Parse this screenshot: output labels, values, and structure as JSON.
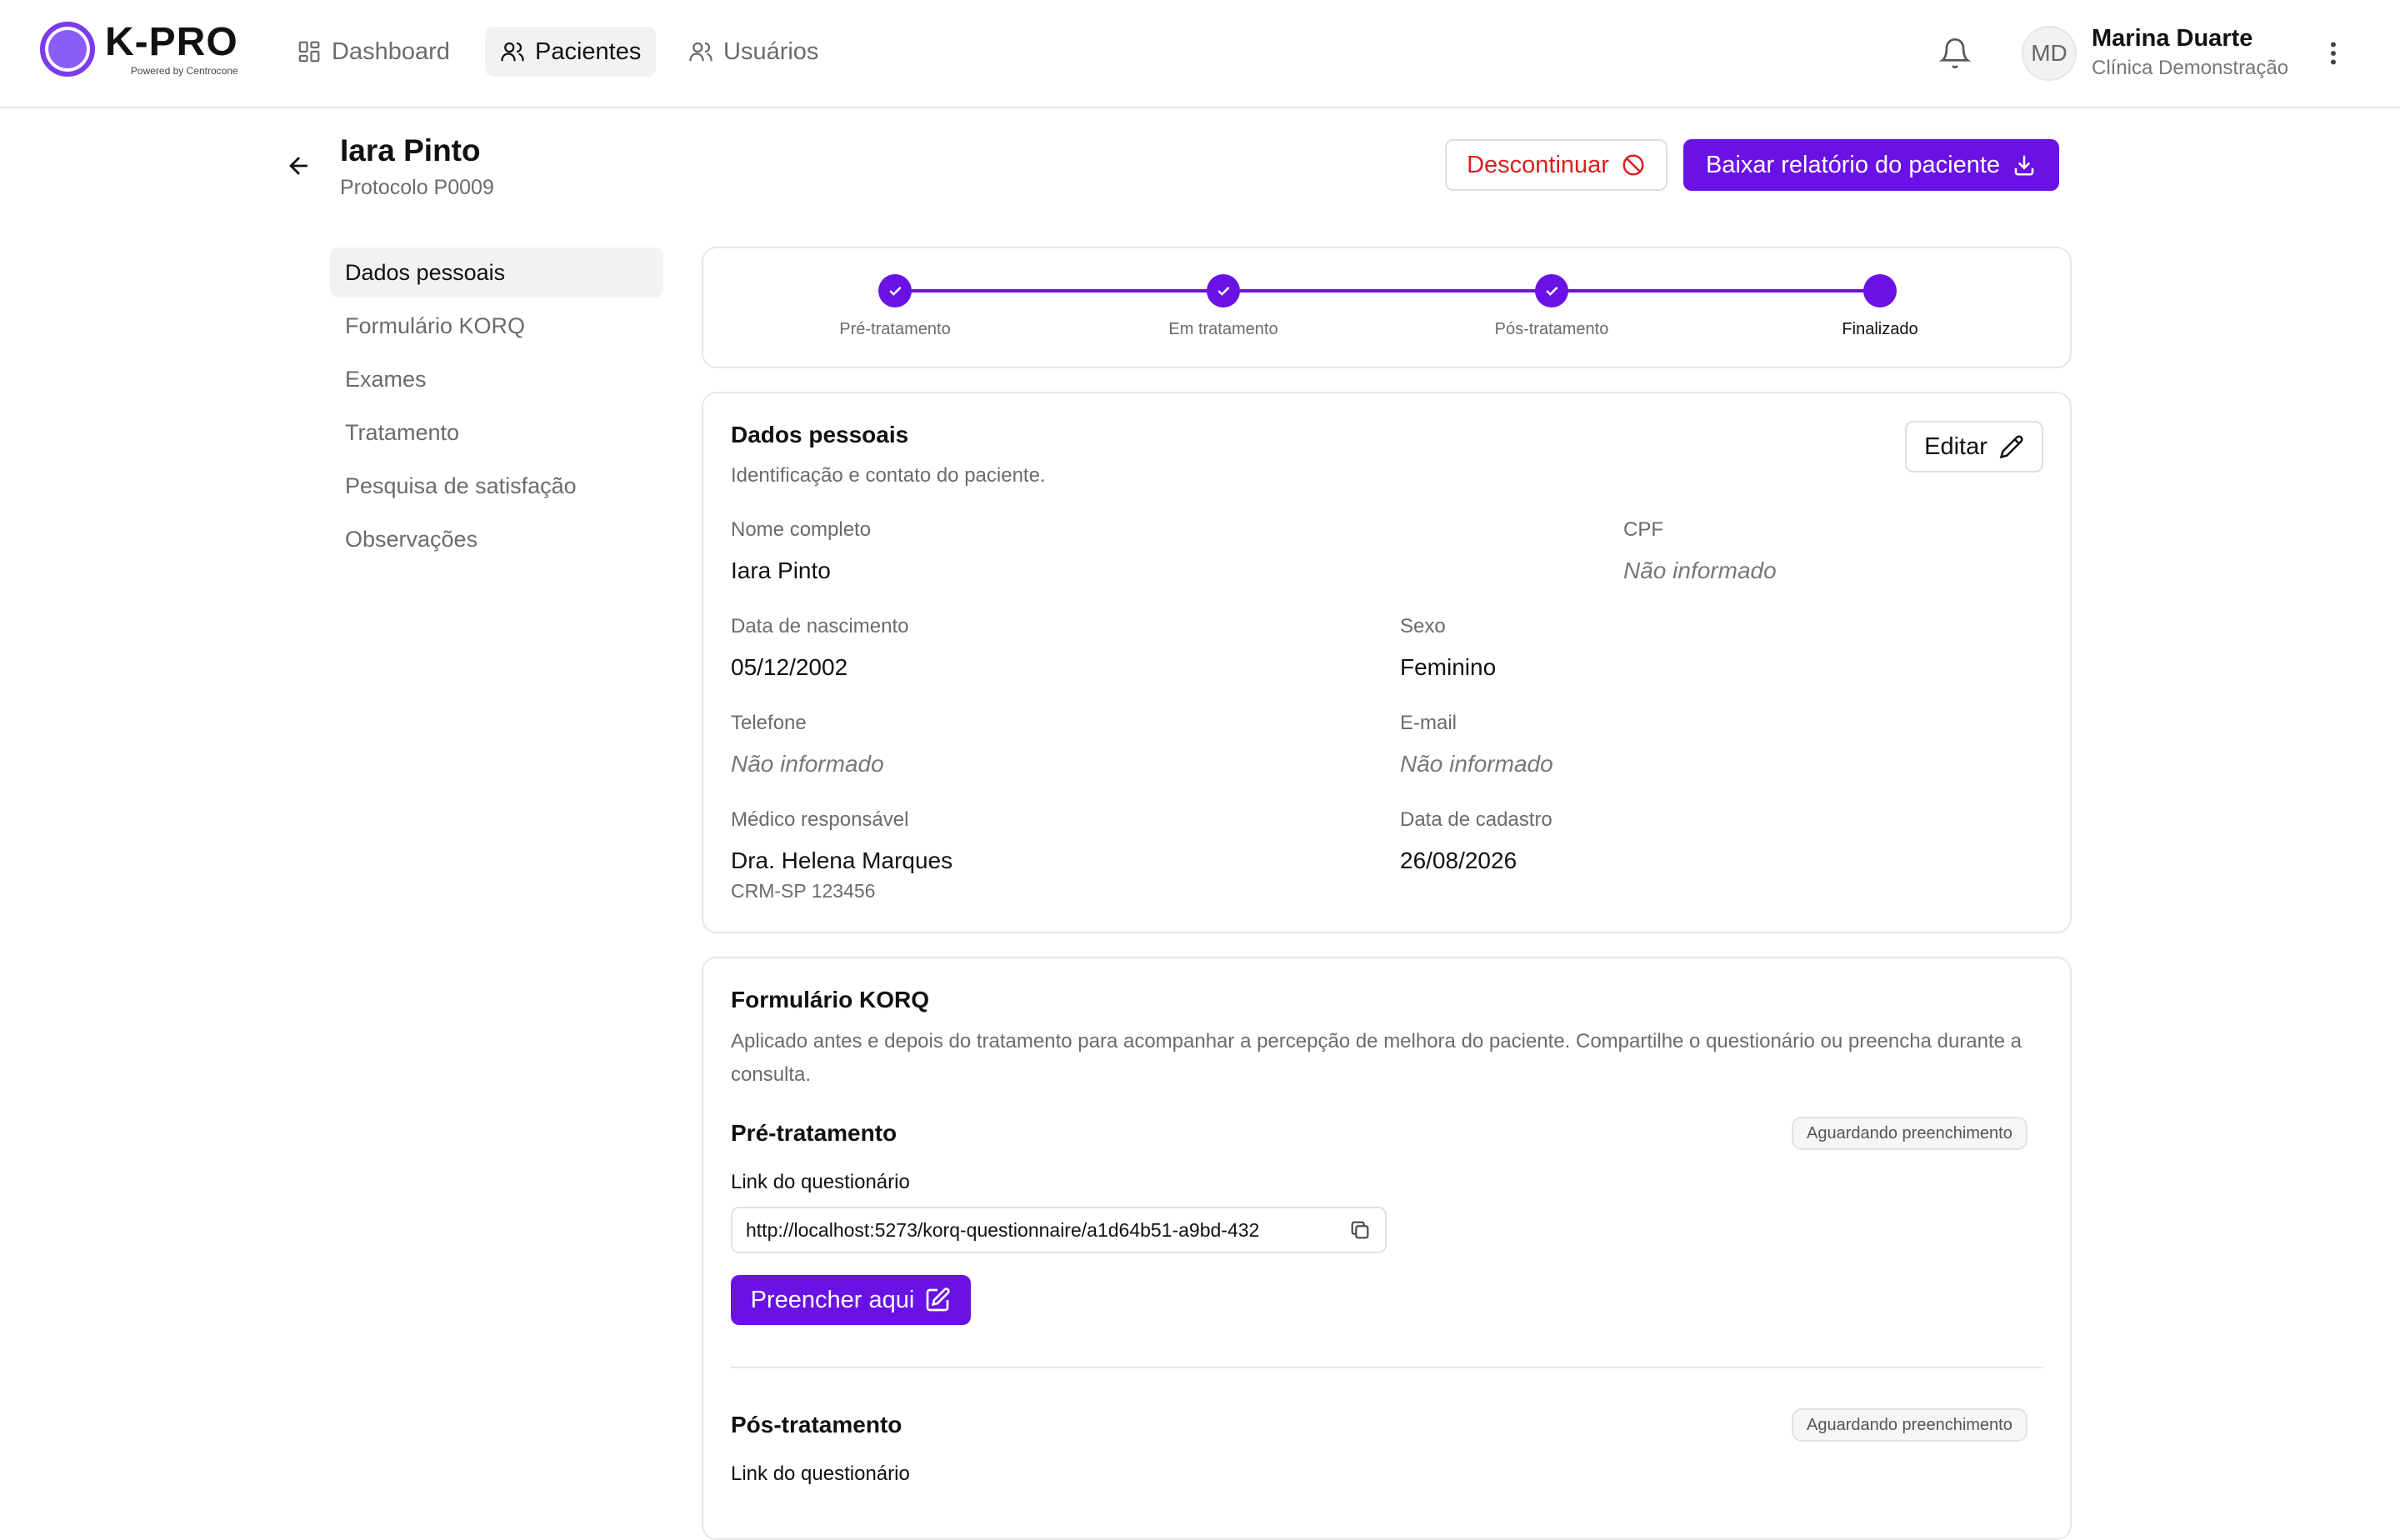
{
  "brand": {
    "name": "K-PRO",
    "tagline": "Powered by Centrocone"
  },
  "nav": [
    {
      "label": "Dashboard",
      "icon": "dashboard-icon"
    },
    {
      "label": "Pacientes",
      "icon": "users-icon",
      "active": true
    },
    {
      "label": "Usuários",
      "icon": "user-icon"
    }
  ],
  "user": {
    "initials": "MD",
    "name": "Marina Duarte",
    "clinic": "Clínica Demonstração"
  },
  "patient": {
    "name": "Iara Pinto",
    "protocol": "Protocolo P0009"
  },
  "actions": {
    "discontinue": "Descontinuar",
    "download": "Baixar relatório do paciente"
  },
  "sidebar": [
    {
      "label": "Dados pessoais",
      "active": true
    },
    {
      "label": "Formulário KORQ"
    },
    {
      "label": "Exames"
    },
    {
      "label": "Tratamento"
    },
    {
      "label": "Pesquisa de satisfação"
    },
    {
      "label": "Observações"
    }
  ],
  "stepper": [
    {
      "label": "Pré-tratamento",
      "done": true
    },
    {
      "label": "Em tratamento",
      "done": true
    },
    {
      "label": "Pós-tratamento",
      "done": true
    },
    {
      "label": "Finalizado",
      "current": true
    }
  ],
  "personal": {
    "title": "Dados pessoais",
    "description": "Identificação e contato do paciente.",
    "edit_label": "Editar",
    "fields": {
      "full_name": {
        "label": "Nome completo",
        "value": "Iara Pinto"
      },
      "cpf": {
        "label": "CPF",
        "value": "Não informado"
      },
      "birth_date": {
        "label": "Data de nascimento",
        "value": "05/12/2002"
      },
      "sex": {
        "label": "Sexo",
        "value": "Feminino"
      },
      "phone": {
        "label": "Telefone",
        "value": "Não informado"
      },
      "email": {
        "label": "E-mail",
        "value": "Não informado"
      },
      "doctor": {
        "label": "Médico responsável",
        "value": "Dra. Helena Marques",
        "sub": "CRM-SP 123456"
      },
      "registered": {
        "label": "Data de cadastro",
        "value": "26/08/2026"
      }
    }
  },
  "korq": {
    "title": "Formulário KORQ",
    "description": "Aplicado antes e depois do tratamento para acompanhar a percepção de melhora do paciente. Compartilhe o questionário ou preencha durante a consulta.",
    "pre": {
      "title": "Pré-tratamento",
      "status": "Aguardando preenchimento",
      "link_label": "Link do questionário",
      "link": "http://localhost:5273/korq-questionnaire/a1d64b51-a9bd-432",
      "fill_label": "Preencher aqui"
    },
    "post": {
      "title": "Pós-tratamento",
      "status": "Aguardando preenchimento",
      "link_label": "Link do questionário"
    }
  },
  "colors": {
    "primary": "#6a12e6",
    "danger": "#dc1e1e",
    "border": "#e6e6e6",
    "muted": "#6b6b6b"
  }
}
